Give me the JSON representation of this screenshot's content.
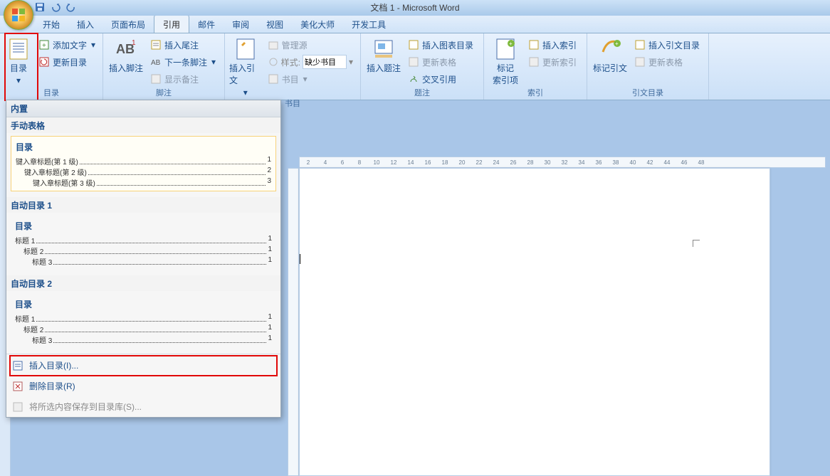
{
  "title": "文档 1 - Microsoft Word",
  "tabs": [
    "开始",
    "插入",
    "页面布局",
    "引用",
    "邮件",
    "审阅",
    "视图",
    "美化大师",
    "开发工具"
  ],
  "active_tab_index": 3,
  "ribbon": {
    "group1": {
      "toc_label": "目录",
      "add_text": "添加文字",
      "update_toc": "更新目录"
    },
    "group2": {
      "insert_footnote": "插入脚注",
      "ab": "AB",
      "insert_endnote": "插入尾注",
      "next_footnote": "下一条脚注",
      "show_notes": "显示备注",
      "label": "脚注"
    },
    "group3": {
      "insert_citation": "插入引文",
      "manage_sources": "管理源",
      "style_lbl": "样式:",
      "style_val": "缺少书目",
      "bibliography": "书目",
      "label": "书目"
    },
    "group4": {
      "insert_caption": "插入题注",
      "insert_fig_table": "插入图表目录",
      "update_table": "更新表格",
      "cross_ref": "交叉引用",
      "label": "题注"
    },
    "group5": {
      "mark_entry": "标记\n索引项",
      "insert_index": "插入索引",
      "update_index": "更新索引",
      "label": "索引"
    },
    "group6": {
      "mark_citation": "标记引文",
      "insert_toa": "插入引文目录",
      "update_toa": "更新表格",
      "label": "引文目录"
    }
  },
  "dropdown": {
    "header": "内置",
    "manual": {
      "section": "手动表格",
      "title": "目录",
      "lines": [
        {
          "txt": "键入章标题(第 1 级)",
          "pg": "1"
        },
        {
          "txt": "键入章标题(第 2 级)",
          "pg": "2"
        },
        {
          "txt": "键入章标题(第 3 级)",
          "pg": "3"
        }
      ]
    },
    "auto1": {
      "section": "自动目录 1",
      "title": "目录",
      "lines": [
        {
          "txt": "标题 1",
          "pg": "1"
        },
        {
          "txt": "标题 2",
          "pg": "1"
        },
        {
          "txt": "标题 3",
          "pg": "1"
        }
      ]
    },
    "auto2": {
      "section": "自动目录 2",
      "title": "目录",
      "lines": [
        {
          "txt": "标题 1",
          "pg": "1"
        },
        {
          "txt": "标题 2",
          "pg": "1"
        },
        {
          "txt": "标题 3",
          "pg": "1"
        }
      ]
    },
    "insert_toc": "插入目录(I)...",
    "remove_toc": "删除目录(R)",
    "save_gallery": "将所选内容保存到目录库(S)..."
  },
  "ruler_ticks": [
    "2",
    "4",
    "6",
    "8",
    "10",
    "12",
    "14",
    "16",
    "18",
    "20",
    "22",
    "24",
    "26",
    "28",
    "30",
    "32",
    "34",
    "36",
    "38",
    "40",
    "42",
    "44",
    "46",
    "48"
  ]
}
